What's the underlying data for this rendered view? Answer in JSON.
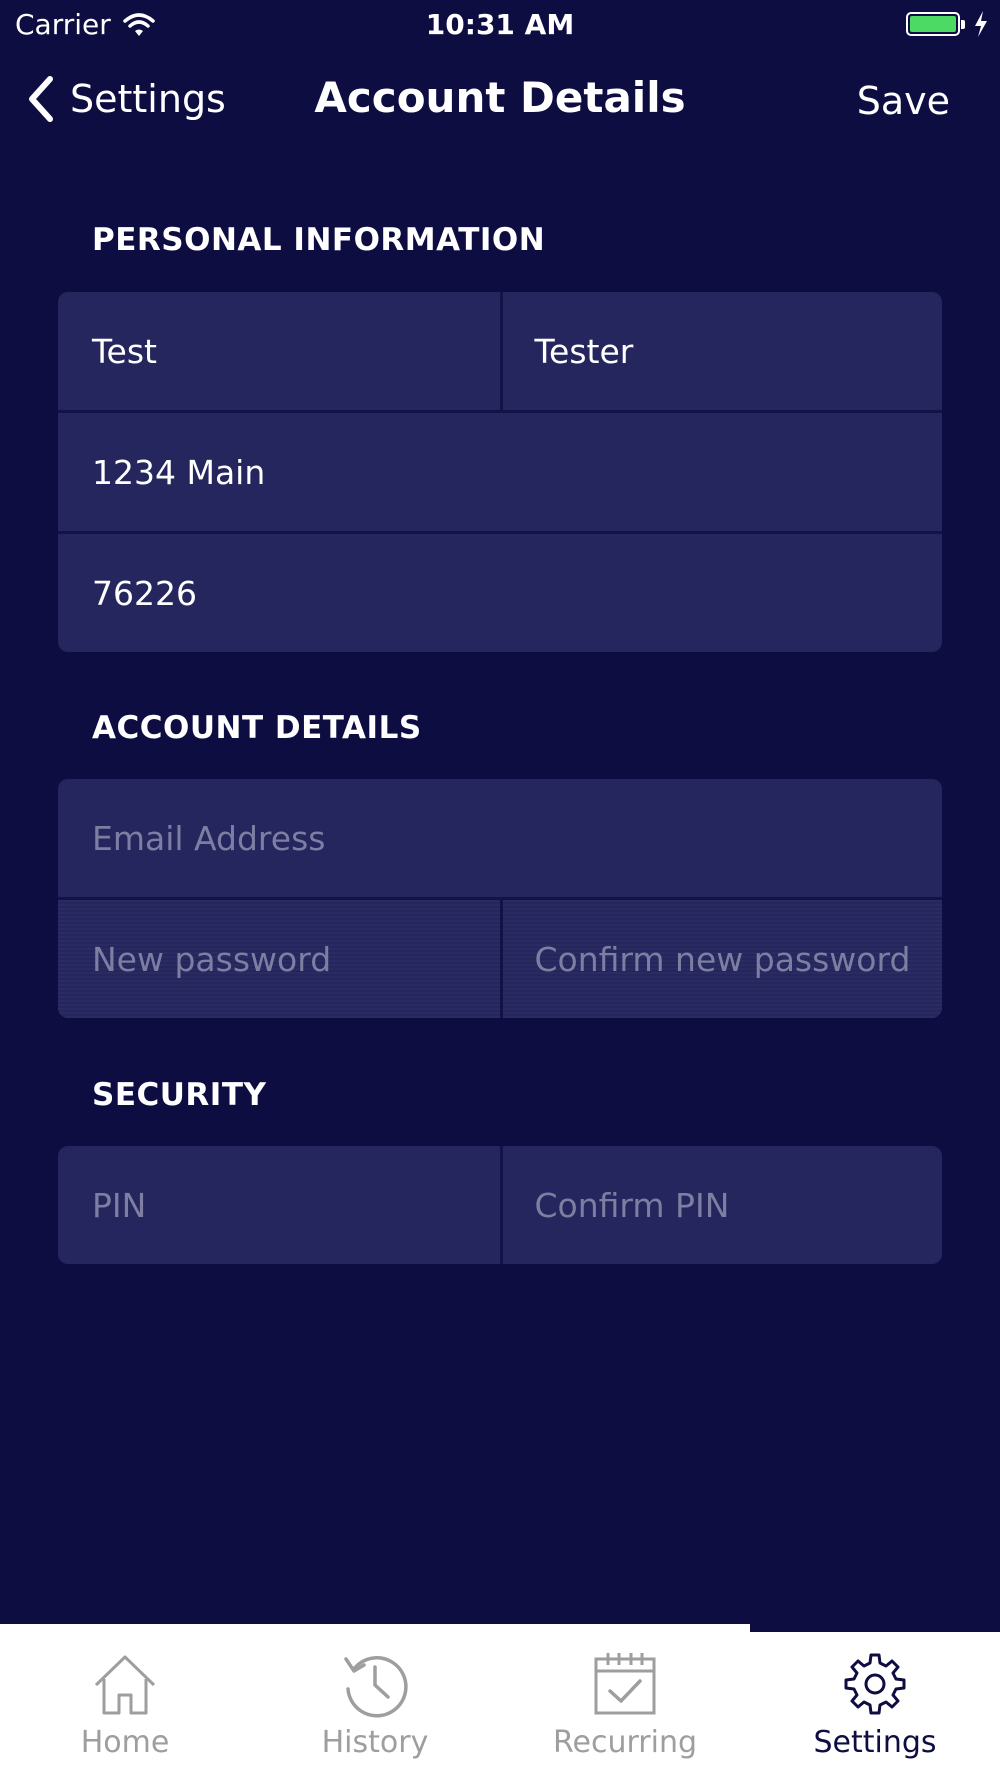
{
  "status_bar": {
    "carrier": "Carrier",
    "time": "10:31 AM",
    "battery_color": "#4cd964"
  },
  "nav": {
    "back_label": "Settings",
    "title": "Account Details",
    "save_label": "Save"
  },
  "personal_information": {
    "header": "PERSONAL INFORMATION",
    "first_name": "Test",
    "last_name": "Tester",
    "address": "1234 Main",
    "zip": "76226"
  },
  "account_details": {
    "header": "ACCOUNT DETAILS",
    "email_placeholder": "Email Address",
    "new_password_placeholder": "New password",
    "confirm_password_placeholder": "Confirm new password"
  },
  "security": {
    "header": "SECURITY",
    "pin_placeholder": "PIN",
    "confirm_pin_placeholder": "Confirm PIN"
  },
  "tabs": [
    {
      "label": "Home",
      "icon": "home-icon",
      "active": false
    },
    {
      "label": "History",
      "icon": "history-icon",
      "active": false
    },
    {
      "label": "Recurring",
      "icon": "calendar-check-icon",
      "active": false
    },
    {
      "label": "Settings",
      "icon": "gear-icon",
      "active": true
    }
  ],
  "colors": {
    "background": "#0e0d42",
    "card": "#25265d",
    "placeholder": "#7d7ea2",
    "tab_inactive": "#9e9e9e"
  }
}
